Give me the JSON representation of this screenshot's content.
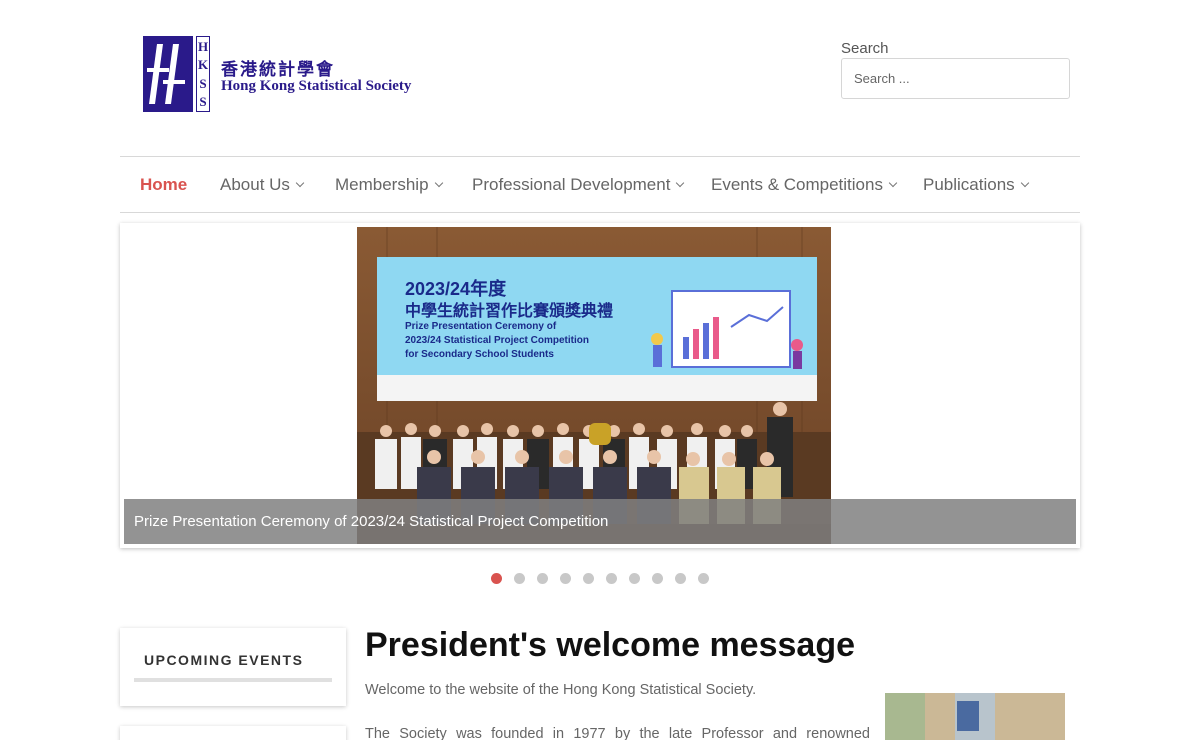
{
  "header": {
    "logo_letters": [
      "H",
      "K",
      "S",
      "S"
    ],
    "logo_name_cn": "香港統計學會",
    "logo_name_en": "Hong Kong Statistical Society",
    "search_label": "Search",
    "search_placeholder": "Search ..."
  },
  "nav": {
    "items": [
      {
        "label": "Home",
        "active": true,
        "dropdown": false
      },
      {
        "label": "About Us",
        "active": false,
        "dropdown": true
      },
      {
        "label": "Membership",
        "active": false,
        "dropdown": true
      },
      {
        "label": "Professional Development",
        "active": false,
        "dropdown": true
      },
      {
        "label": "Events & Competitions",
        "active": false,
        "dropdown": true
      },
      {
        "label": "Publications",
        "active": false,
        "dropdown": true
      }
    ]
  },
  "slider": {
    "caption": "Prize Presentation Ceremony of 2023/24 Statistical Project Competition",
    "banner_year": "2023/24年度",
    "banner_title_cn": "中學生統計習作比賽頒獎典禮",
    "banner_line1": "Prize Presentation Ceremony of",
    "banner_line2": "2023/24 Statistical Project Competition",
    "banner_line3": "for Secondary School Students",
    "dot_count": 10,
    "active_dot": 0
  },
  "sidebar": {
    "upcoming_title": "UPCOMING EVENTS"
  },
  "main": {
    "title": "President's welcome message",
    "para1": "Welcome to the website of the Hong Kong Statistical Society.",
    "para2": "The Society was founded in 1977 by the late Professor and renowned"
  },
  "colors": {
    "brand": "#2a1a8a",
    "accent": "#d9534f",
    "caption_bg": "#808080"
  }
}
